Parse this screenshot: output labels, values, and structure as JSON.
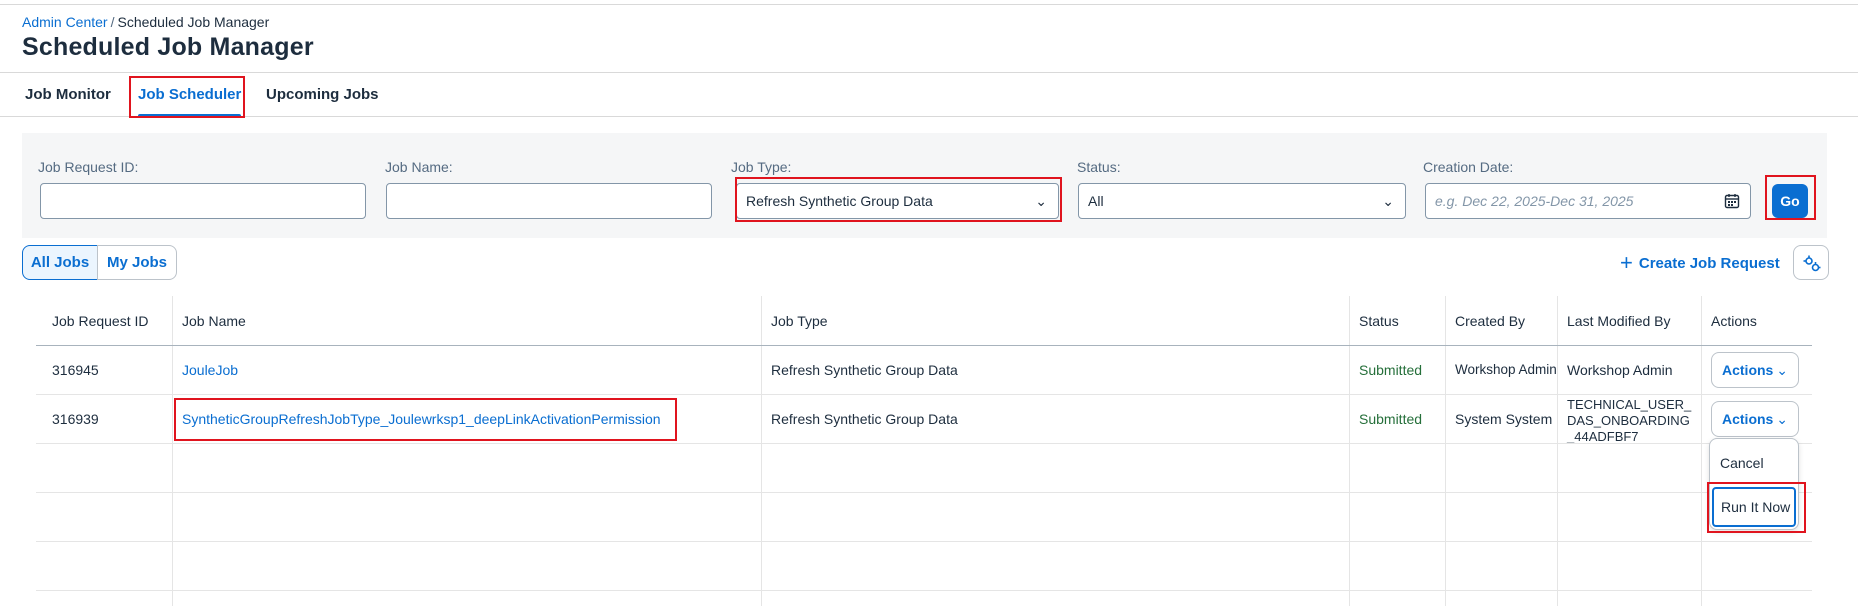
{
  "breadcrumb": {
    "root": "Admin Center",
    "separator": "/",
    "current": "Scheduled Job Manager"
  },
  "page": {
    "title": "Scheduled Job Manager"
  },
  "tabs": [
    {
      "label": "Job Monitor"
    },
    {
      "label": "Job Scheduler",
      "active": true
    },
    {
      "label": "Upcoming Jobs"
    }
  ],
  "filters": {
    "job_request_id": {
      "label": "Job Request ID:",
      "value": ""
    },
    "job_name": {
      "label": "Job Name:",
      "value": ""
    },
    "job_type": {
      "label": "Job Type:",
      "value": "Refresh Synthetic Group Data"
    },
    "status": {
      "label": "Status:",
      "value": "All"
    },
    "creation_date": {
      "label": "Creation Date:",
      "placeholder": "e.g. Dec 22, 2025-Dec 31, 2025"
    },
    "go_label": "Go"
  },
  "segments": {
    "all_jobs": "All Jobs",
    "my_jobs": "My Jobs"
  },
  "toolbar": {
    "create_label": "Create Job Request"
  },
  "table": {
    "headers": [
      "Job Request ID",
      "Job Name",
      "Job Type",
      "Status",
      "Created By",
      "Last Modified By",
      "Actions"
    ],
    "rows": [
      {
        "id": "316945",
        "name": "JouleJob",
        "type": "Refresh Synthetic Group Data",
        "status": "Submitted",
        "created_by": "Workshop Admin",
        "modified_by": "Workshop Admin",
        "actions_label": "Actions"
      },
      {
        "id": "316939",
        "name": "SyntheticGroupRefreshJobType_Joulewrksp1_deepLinkActivationPermission",
        "type": "Refresh Synthetic Group Data",
        "status": "Submitted",
        "created_by": "System System",
        "modified_by": "TECHNICAL_USER_ DAS_ONBOARDING _44ADFBF7",
        "actions_label": "Actions"
      }
    ]
  },
  "actions_menu": {
    "items": [
      "Cancel",
      "Run It Now"
    ]
  },
  "colors": {
    "accent": "#0a6ed1",
    "highlight": "#e0141e",
    "status_positive": "#256f3a"
  },
  "icons": {
    "dropdown": "chevron-down-icon",
    "calendar": "calendar-icon",
    "create": "plus-icon",
    "settings": "settings-icon"
  }
}
